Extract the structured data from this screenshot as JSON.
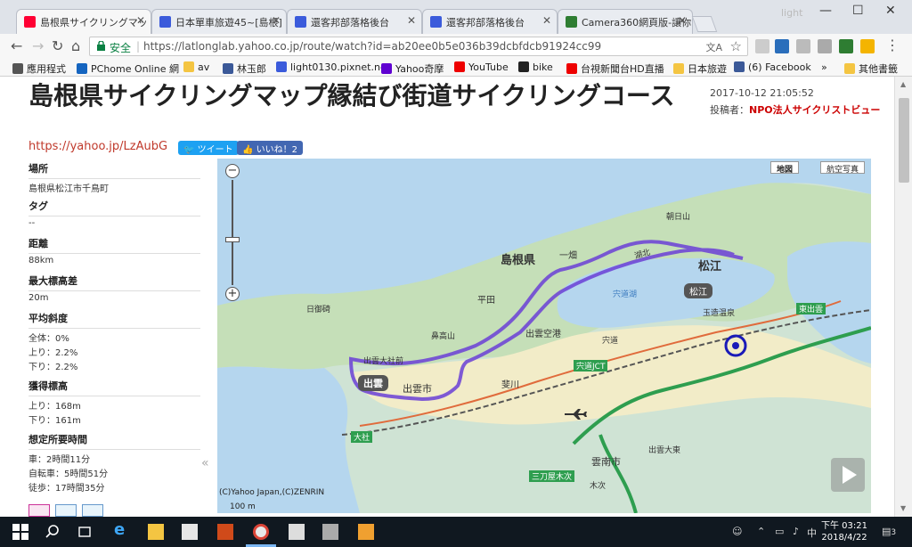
{
  "browser": {
    "tabs": [
      {
        "label": "島根県サイクリングマッ",
        "color": "#ff0033"
      },
      {
        "label": "日本單車旅遊45~[島根]",
        "color": "#3b5bdb"
      },
      {
        "label": "還客邦部落格後台",
        "color": "#3b5bdb"
      },
      {
        "label": "還客邦部落格後台",
        "color": "#3b5bdb"
      },
      {
        "label": "Camera360網頁版-讓你",
        "color": "#2e7d32"
      }
    ],
    "profile": "light",
    "secure_label": "安全",
    "url": "https://latlonglab.yahoo.co.jp/route/watch?id=ab20ee0b5e036b39dcbfdcb91924cc99",
    "bookmarks": [
      "應用程式",
      "PChome Online 網",
      "av",
      "林玉郎",
      "light0130.pixnet.ne",
      "Yahoo奇摩",
      "YouTube",
      "bike",
      "台視新聞台HD直播",
      "日本旅遊",
      "(6) Facebook",
      "»",
      "其他書籤"
    ]
  },
  "page": {
    "title": "島根県サイクリングマップ縁結び街道サイクリングコース",
    "date": "2017-10-12 21:05:52",
    "poster_label": "投稿者：",
    "poster": "NPO法人サイクリストビュー",
    "short_url": "https://yahoo.jp/LzAubG",
    "tweet_label": "ツイート",
    "like_label": "いいね！2"
  },
  "info": [
    {
      "label": "場所",
      "values": [
        "島根県松江市千鳥町"
      ]
    },
    {
      "label": "タグ",
      "values": [
        "--"
      ]
    },
    {
      "label": "距離",
      "values": [
        "88km"
      ]
    },
    {
      "label": "最大標高差",
      "values": [
        "20m"
      ]
    },
    {
      "label": "平均斜度",
      "values": [
        "全体：0%",
        "上り：2.2%",
        "下り：2.2%"
      ]
    },
    {
      "label": "獲得標高",
      "values": [
        "上り：168m",
        "下り：161m"
      ]
    },
    {
      "label": "想定所要時間",
      "values": [
        "車：2時間11分",
        "自転車：5時間51分",
        "徒歩：17時間35分"
      ]
    }
  ],
  "map": {
    "type_buttons": [
      "地図",
      "航空写真"
    ],
    "copyright": "(C)Yahoo Japan,(C)ZENRIN",
    "scale": "100 m",
    "labels": [
      {
        "text": "島根県",
        "bold": true
      },
      {
        "text": "松江",
        "bold": true
      },
      {
        "text": "松江",
        "bold": false
      },
      {
        "text": "出雲",
        "bold": true
      },
      {
        "text": "出雲市",
        "bold": false
      },
      {
        "text": "出雲空港",
        "bold": false
      },
      {
        "text": "宍道湖",
        "bold": false
      },
      {
        "text": "雲南市",
        "bold": false
      },
      {
        "text": "出雲大社前",
        "bold": false
      },
      {
        "text": "宍道JCT",
        "bold": false
      },
      {
        "text": "宍道",
        "bold": false
      },
      {
        "text": "玉造温泉",
        "bold": false
      },
      {
        "text": "斐川",
        "bold": false
      },
      {
        "text": "平田",
        "bold": false
      },
      {
        "text": "鼻高山",
        "bold": false
      },
      {
        "text": "日御碕",
        "bold": false
      },
      {
        "text": "朝日山",
        "bold": false
      },
      {
        "text": "東出雲",
        "bold": false
      },
      {
        "text": "三刀屋木次",
        "bold": false
      },
      {
        "text": "出雲大東",
        "bold": false
      },
      {
        "text": "木次",
        "bold": false
      },
      {
        "text": "大社",
        "bold": false
      },
      {
        "text": "一畑",
        "bold": false
      },
      {
        "text": "湖北",
        "bold": false
      }
    ]
  },
  "taskbar": {
    "time": "下午 03:21",
    "date": "2018/4/22",
    "notifications": "3"
  }
}
